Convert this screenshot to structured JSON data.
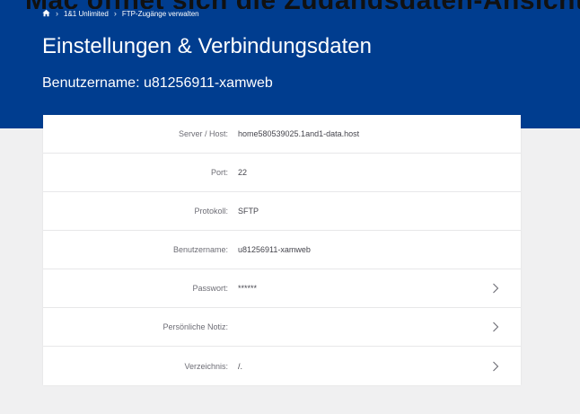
{
  "overlay_text": "Mac öffnet sich die Zugangsdaten-Ansicht bei",
  "breadcrumb": {
    "items": [
      "1&1 Unlimited",
      "FTP-Zugänge verwalten"
    ]
  },
  "page": {
    "title": "Einstellungen & Verbindungsdaten",
    "subtitle": "Benutzername: u81256911-xamweb"
  },
  "colors": {
    "header_bg": "#003d8f",
    "page_bg": "#f0f0f1",
    "card_bg": "#ffffff"
  },
  "details": {
    "rows": [
      {
        "label": "Server / Host:",
        "value": "home580539025.1and1-data.host",
        "has_chevron": false
      },
      {
        "label": "Port:",
        "value": "22",
        "has_chevron": false
      },
      {
        "label": "Protokoll:",
        "value": "SFTP",
        "has_chevron": false
      },
      {
        "label": "Benutzername:",
        "value": "u81256911-xamweb",
        "has_chevron": false
      },
      {
        "label": "Passwort:",
        "value": "******",
        "has_chevron": true
      },
      {
        "label": "Persönliche Notiz:",
        "value": "",
        "has_chevron": true
      },
      {
        "label": "Verzeichnis:",
        "value": "/.",
        "has_chevron": true
      }
    ]
  },
  "icons": {
    "home": "home-icon",
    "chevron": "chevron-right-icon"
  }
}
